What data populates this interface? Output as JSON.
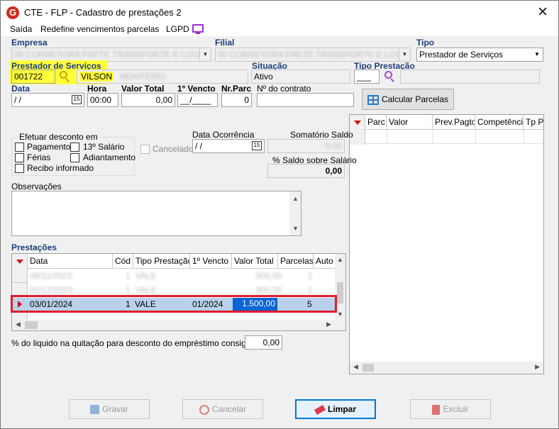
{
  "window": {
    "title": "CTE - FLP - Cadastro de prestações 2",
    "logo_letter": "G",
    "close_label": "✕"
  },
  "menu": [
    "Saída",
    "Redefine vencimentos parcelas",
    "LGPD"
  ],
  "labels": {
    "empresa": "Empresa",
    "filial": "Filial",
    "tipo": "Tipo",
    "prestador": "Prestador de Serviços",
    "situacao": "Situação",
    "tipo_prestacao": "Tipo Prestação",
    "data": "Data",
    "hora": "Hora",
    "valor_total": "Valor Total",
    "primeiro_vencto": "1º Vencto",
    "nr_parc": "Nr.Parc",
    "contrato": "Nº do contrato",
    "desconto_group": "Efetuar desconto em",
    "data_ocorrencia": "Data Ocorrência",
    "somatorio_saldo": "Somatório Saldo",
    "saldo_salario": "% Saldo sobre Salário",
    "observacoes": "Observações",
    "prestacoes": "Prestações",
    "consignado": "% do liquido na quitação para desconto do empréstimo consignado"
  },
  "fields": {
    "empresa": "00 CORRETORA FRETE TRANSPORTE E LOGISTICA",
    "filial": "00 CORRETORA FRETE TRANSPORTE E LOGISTICA",
    "tipo": "Prestador de Serviços",
    "prestador_code": "001722",
    "prestador_name": "VILSON",
    "prestador_name_blur": "MONTEIRO",
    "situacao": "Ativo",
    "tipo_prestacao_code": "___",
    "data": " / /",
    "hora": "00:00",
    "valor_total": "0,00",
    "primeiro_vencto": "__/____",
    "nr_parc": "0",
    "contrato": "",
    "data_ocorrencia": " / /",
    "somatorio_saldo": "0,00",
    "saldo_salario": "0,00",
    "consignado": "0,00"
  },
  "checkboxes": {
    "pagamento": "Pagamento",
    "decimo": "13º Salário",
    "ferias": "Férias",
    "adiantamento": "Adiantamento",
    "recibo": "Recibo informado",
    "cancelado": "Cancelado"
  },
  "buttons": {
    "calcular": "Calcular Parcelas",
    "gravar": "Gravar",
    "cancelar": "Cancelar",
    "limpar": "Limpar",
    "excluir": "Excluir"
  },
  "parcelas_grid": {
    "columns": [
      "Parc",
      "Valor",
      "Prev.Pagto",
      "Competência",
      "Tp Pa"
    ]
  },
  "prestacoes_grid": {
    "columns": [
      "Data",
      "Cód",
      "Tipo Prestação",
      "1º Vencto",
      "Valor Total",
      "Parcelas",
      "Auto c"
    ],
    "rows": [
      {
        "data": "09/11/2023",
        "cod": "1",
        "tipo": "VALE",
        "vencto": "",
        "valor": "500,00",
        "parcelas": "1",
        "blurred": true
      },
      {
        "data": "01/12/2023",
        "cod": "1",
        "tipo": "VALE",
        "vencto": "",
        "valor": "800,00",
        "parcelas": "1",
        "blurred": true
      },
      {
        "data": "03/01/2024",
        "cod": "1",
        "tipo": "VALE",
        "vencto": "01/2024",
        "valor": "1.500,00",
        "parcelas": "5",
        "blurred": false
      }
    ]
  },
  "colors": {
    "accent_blue_label": "#1d3d7a",
    "highlight_yellow": "#ffff3c",
    "selection_red": "#e01d2b",
    "selected_row": "#b9d1ea",
    "focus_cell": "#0a64d4"
  }
}
